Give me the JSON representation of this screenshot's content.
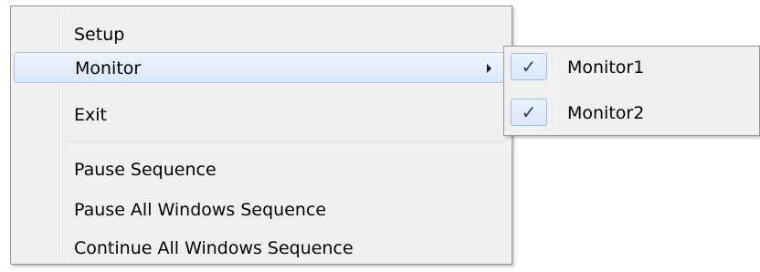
{
  "menu": {
    "items": [
      {
        "label": "Setup"
      },
      {
        "label": "Monitor"
      },
      {
        "label": "Exit"
      },
      {
        "label": "Pause Sequence"
      },
      {
        "label": "Pause All Windows Sequence"
      },
      {
        "label": "Continue All Windows Sequence"
      }
    ],
    "highlighted": "Monitor",
    "submenu_arrow_icon": "chevron-right-icon"
  },
  "submenu": {
    "items": [
      {
        "label": "Monitor1",
        "checked": true,
        "check_glyph": "✓"
      },
      {
        "label": "Monitor2",
        "checked": true,
        "check_glyph": "✓"
      }
    ]
  },
  "colors": {
    "menu_bg": "#f0f0f0",
    "highlight_border": "#a9c6ea",
    "check_color": "#1f3f8c"
  }
}
